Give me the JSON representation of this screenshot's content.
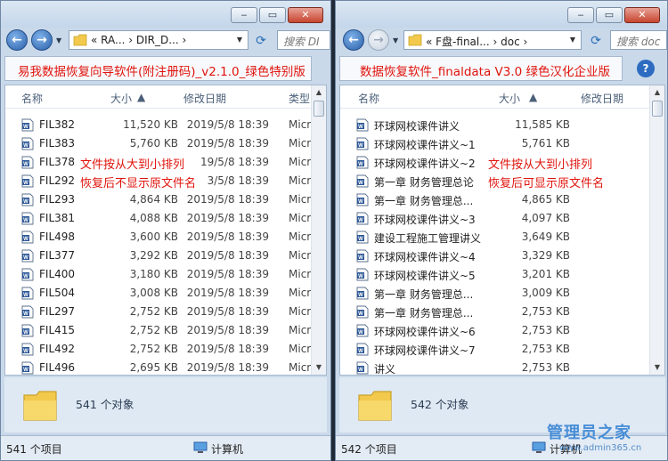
{
  "left": {
    "address": "«  RA...  ›  DIR_D...  ›",
    "search_placeholder": "搜索 DI",
    "banner": "易我数据恢复向导软件(附注册码)_v2.1.0_绿色特别版",
    "columns": {
      "name": "名称",
      "size": "大小",
      "date": "修改日期",
      "type": "类型"
    },
    "rows": [
      {
        "name": "FIL382",
        "size": "11,520 KB",
        "date": "2019/5/8 18:39",
        "type": "Micr"
      },
      {
        "name": "FIL383",
        "size": "5,760 KB",
        "date": "2019/5/8 18:39",
        "type": "Micr"
      },
      {
        "name": "FIL378",
        "size": "",
        "date": "19/5/8 18:39",
        "type": "Micr"
      },
      {
        "name": "FIL292",
        "size": "",
        "date": "3/5/8 18:39",
        "type": "Micr"
      },
      {
        "name": "FIL293",
        "size": "4,864 KB",
        "date": "2019/5/8 18:39",
        "type": "Micr"
      },
      {
        "name": "FIL381",
        "size": "4,088 KB",
        "date": "2019/5/8 18:39",
        "type": "Micr"
      },
      {
        "name": "FIL498",
        "size": "3,600 KB",
        "date": "2019/5/8 18:39",
        "type": "Micr"
      },
      {
        "name": "FIL377",
        "size": "3,292 KB",
        "date": "2019/5/8 18:39",
        "type": "Micr"
      },
      {
        "name": "FIL400",
        "size": "3,180 KB",
        "date": "2019/5/8 18:39",
        "type": "Micr"
      },
      {
        "name": "FIL504",
        "size": "3,008 KB",
        "date": "2019/5/8 18:39",
        "type": "Micr"
      },
      {
        "name": "FIL297",
        "size": "2,752 KB",
        "date": "2019/5/8 18:39",
        "type": "Micr"
      },
      {
        "name": "FIL415",
        "size": "2,752 KB",
        "date": "2019/5/8 18:39",
        "type": "Micr"
      },
      {
        "name": "FIL492",
        "size": "2,752 KB",
        "date": "2019/5/8 18:39",
        "type": "Micr"
      },
      {
        "name": "FIL496",
        "size": "2,695 KB",
        "date": "2019/5/8 18:39",
        "type": "Micr"
      }
    ],
    "note1": "文件按从大到小排列",
    "note2": "恢复后不显示原文件名",
    "object_count": "541 个对象",
    "status_items": "541 个项目",
    "status_computer": "计算机"
  },
  "right": {
    "address": "«  F盘-final...  ›  doc  ›",
    "search_placeholder": "搜索 doc",
    "banner": "数据恢复软件_finaldata V3.0 绿色汉化企业版",
    "columns": {
      "name": "名称",
      "size": "大小",
      "date": "修改日期"
    },
    "rows": [
      {
        "name": "环球网校课件讲义",
        "size": "11,585 KB"
      },
      {
        "name": "环球网校课件讲义~1",
        "size": "5,761 KB"
      },
      {
        "name": "环球网校课件讲义~2",
        "size": ""
      },
      {
        "name": "第一章  财务管理总论",
        "size": ""
      },
      {
        "name": "第一章  财务管理总...",
        "size": "4,865 KB"
      },
      {
        "name": "环球网校课件讲义~3",
        "size": "4,097 KB"
      },
      {
        "name": "建设工程施工管理讲义",
        "size": "3,649 KB"
      },
      {
        "name": "环球网校课件讲义~4",
        "size": "3,329 KB"
      },
      {
        "name": "环球网校课件讲义~5",
        "size": "3,201 KB"
      },
      {
        "name": "第一章  财务管理总...",
        "size": "3,009 KB"
      },
      {
        "name": "第一章  财务管理总...",
        "size": "2,753 KB"
      },
      {
        "name": "环球网校课件讲义~6",
        "size": "2,753 KB"
      },
      {
        "name": "环球网校课件讲义~7",
        "size": "2,753 KB"
      },
      {
        "name": "讲义",
        "size": "2,753 KB"
      }
    ],
    "note1": "文件按从大到小排列",
    "note2": "恢复后可显示原文件名",
    "object_count": "542 个对象",
    "status_items": "542 个项目",
    "status_computer": "计算机"
  },
  "watermark": {
    "title": "管理员之家",
    "url": "www.admin365.cn"
  },
  "icons": [
    "back-arrow-icon",
    "forward-arrow-icon",
    "folder-icon",
    "refresh-icon",
    "search-icon",
    "word-doc-icon",
    "computer-icon",
    "help-icon"
  ],
  "colors": {
    "annotation": "#e0140d",
    "accent": "#2a5fa8"
  }
}
